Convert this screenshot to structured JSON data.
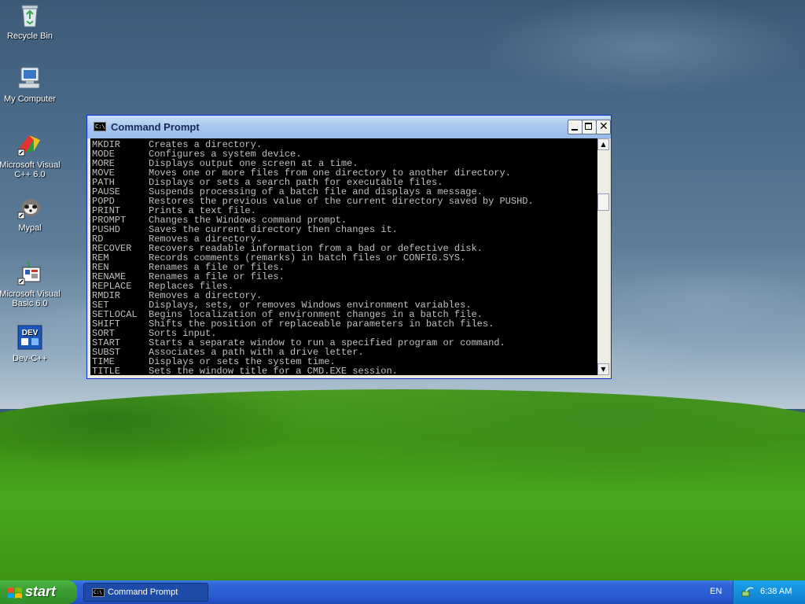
{
  "desktop": {
    "icons": [
      {
        "label": "Recycle Bin"
      },
      {
        "label": "My Computer"
      },
      {
        "label": "Microsoft Visual C++ 6.0"
      },
      {
        "label": "Mypal"
      },
      {
        "label": "Microsoft Visual Basic 6.0"
      },
      {
        "label": "Dev-C++"
      }
    ]
  },
  "window": {
    "title": "Command Prompt",
    "icon_text": "C:\\",
    "lines": [
      {
        "cmd": "MKDIR",
        "desc": "Creates a directory."
      },
      {
        "cmd": "MODE",
        "desc": "Configures a system device."
      },
      {
        "cmd": "MORE",
        "desc": "Displays output one screen at a time."
      },
      {
        "cmd": "MOVE",
        "desc": "Moves one or more files from one directory to another directory."
      },
      {
        "cmd": "PATH",
        "desc": "Displays or sets a search path for executable files."
      },
      {
        "cmd": "PAUSE",
        "desc": "Suspends processing of a batch file and displays a message."
      },
      {
        "cmd": "POPD",
        "desc": "Restores the previous value of the current directory saved by PUSHD."
      },
      {
        "cmd": "PRINT",
        "desc": "Prints a text file."
      },
      {
        "cmd": "PROMPT",
        "desc": "Changes the Windows command prompt."
      },
      {
        "cmd": "PUSHD",
        "desc": "Saves the current directory then changes it."
      },
      {
        "cmd": "RD",
        "desc": "Removes a directory."
      },
      {
        "cmd": "RECOVER",
        "desc": "Recovers readable information from a bad or defective disk."
      },
      {
        "cmd": "REM",
        "desc": "Records comments (remarks) in batch files or CONFIG.SYS."
      },
      {
        "cmd": "REN",
        "desc": "Renames a file or files."
      },
      {
        "cmd": "RENAME",
        "desc": "Renames a file or files."
      },
      {
        "cmd": "REPLACE",
        "desc": "Replaces files."
      },
      {
        "cmd": "RMDIR",
        "desc": "Removes a directory."
      },
      {
        "cmd": "SET",
        "desc": "Displays, sets, or removes Windows environment variables."
      },
      {
        "cmd": "SETLOCAL",
        "desc": "Begins localization of environment changes in a batch file."
      },
      {
        "cmd": "SHIFT",
        "desc": "Shifts the position of replaceable parameters in batch files."
      },
      {
        "cmd": "SORT",
        "desc": "Sorts input."
      },
      {
        "cmd": "START",
        "desc": "Starts a separate window to run a specified program or command."
      },
      {
        "cmd": "SUBST",
        "desc": "Associates a path with a drive letter."
      },
      {
        "cmd": "TIME",
        "desc": "Displays or sets the system time."
      },
      {
        "cmd": "TITLE",
        "desc": "Sets the window title for a CMD.EXE session."
      }
    ]
  },
  "taskbar": {
    "start_label": "start",
    "task_label": "Command Prompt",
    "task_icon_text": "C:\\",
    "language": "EN",
    "clock": "6:38 AM"
  },
  "colors": {
    "console_bg": "#000000",
    "console_text": "#c0c0c0",
    "taskbar_blue": "#2a5bd3",
    "start_green": "#3c9f33"
  }
}
